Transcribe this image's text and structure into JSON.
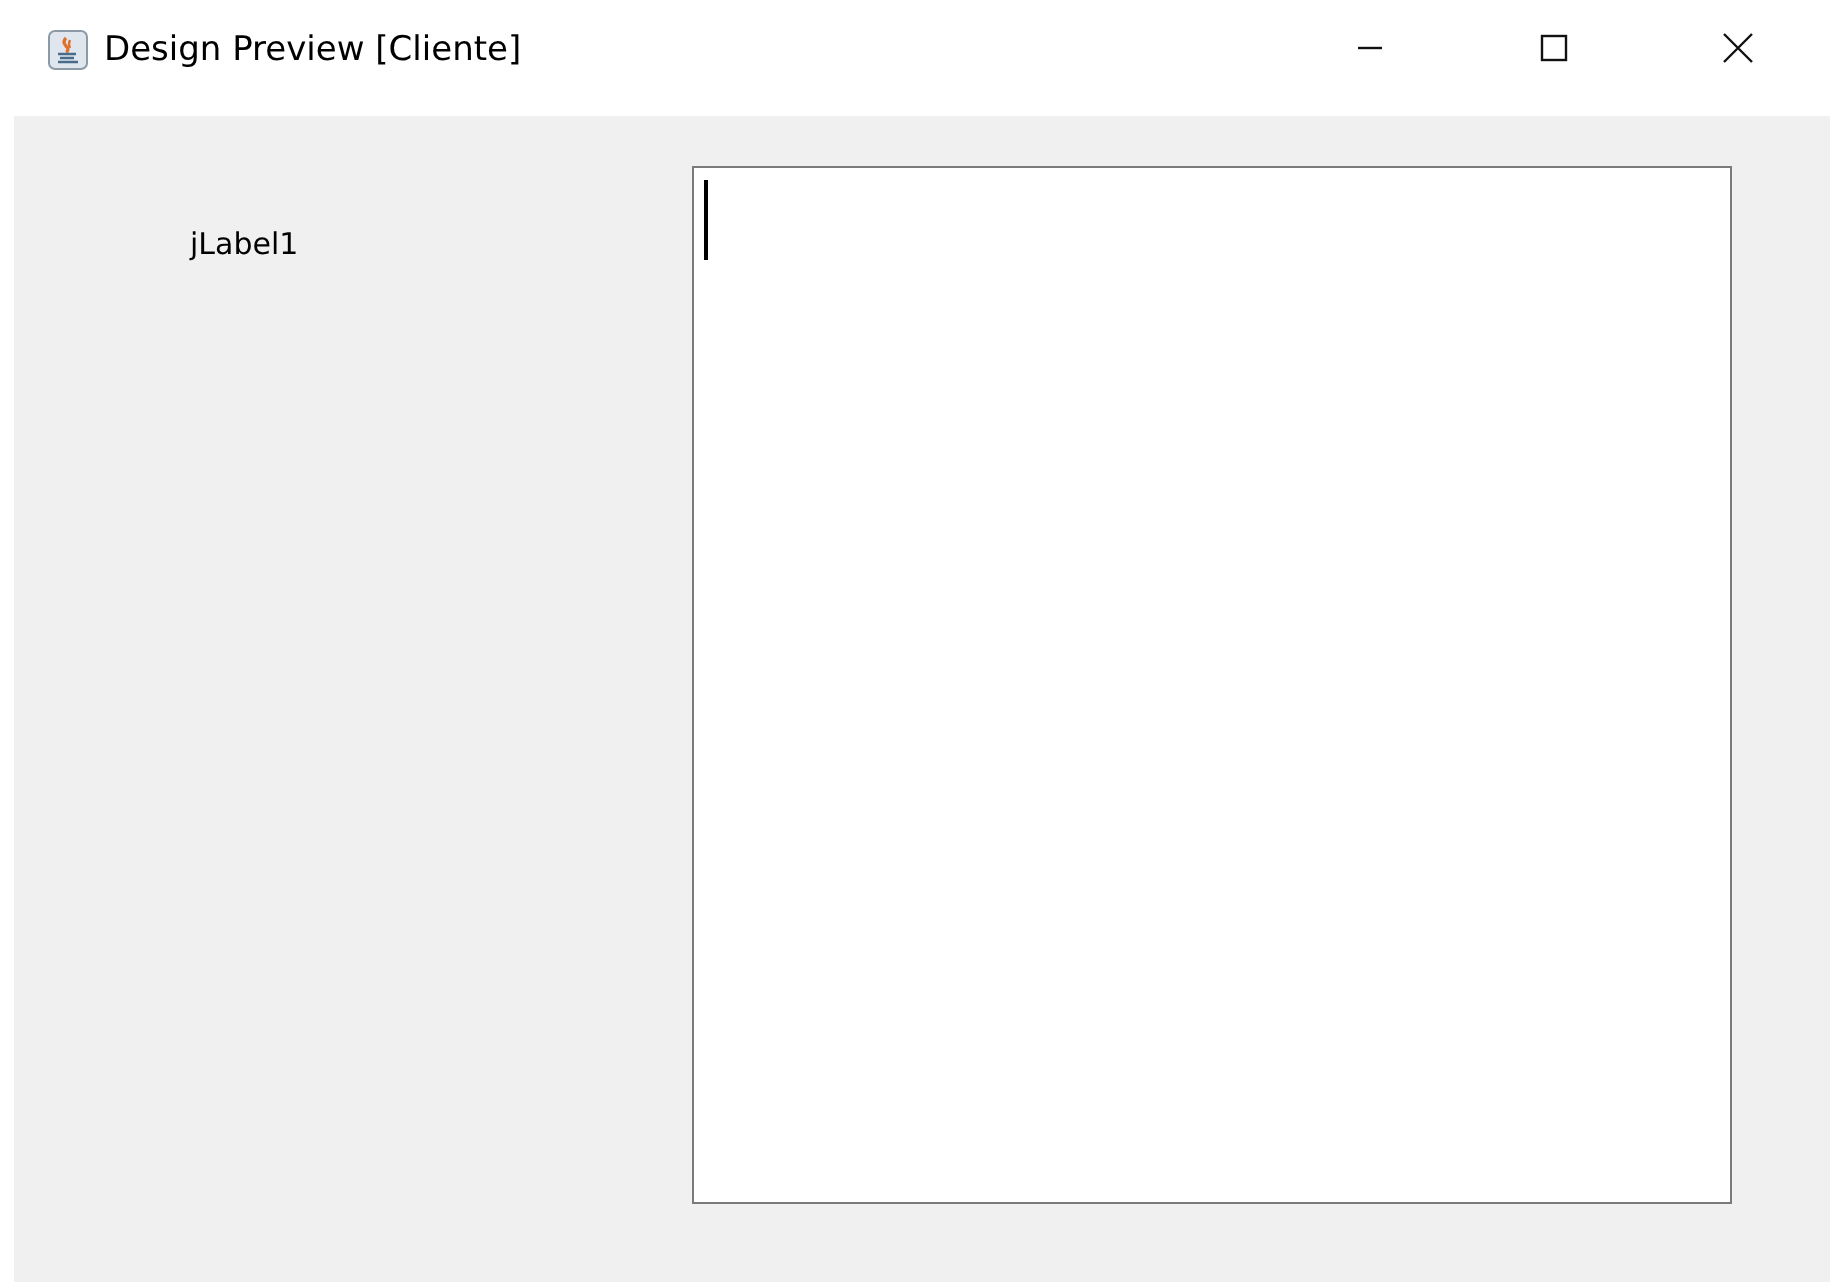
{
  "window": {
    "title": "Design Preview [Cliente]"
  },
  "label": "jLabel1",
  "text_area": {
    "focused": true
  }
}
